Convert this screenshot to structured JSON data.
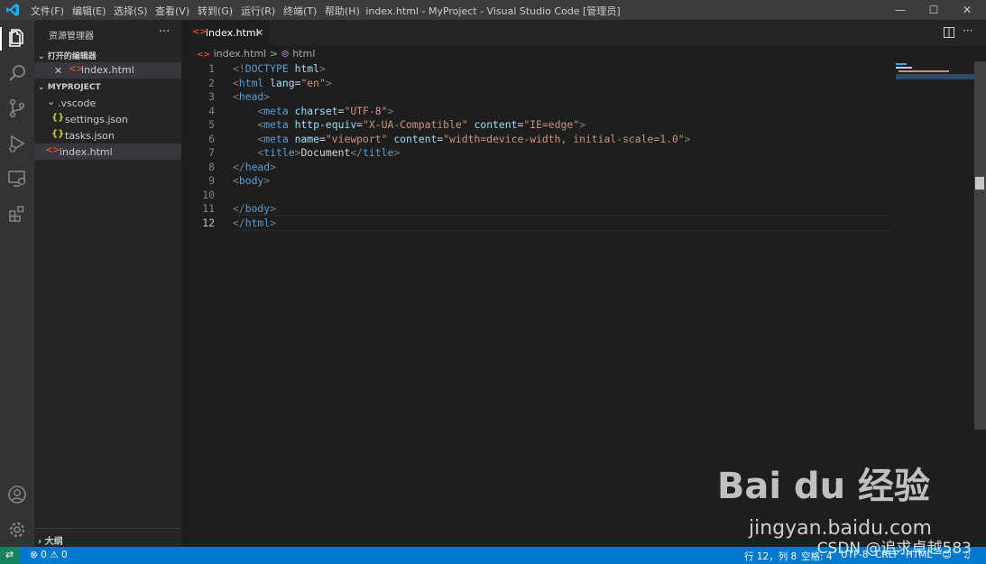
{
  "window": {
    "title": "index.html - MyProject - Visual Studio Code [管理员]",
    "menu": [
      "文件(F)",
      "编辑(E)",
      "选择(S)",
      "查看(V)",
      "转到(G)",
      "运行(R)",
      "终端(T)",
      "帮助(H)"
    ],
    "controls": {
      "minimize": "—",
      "maximize": "☐",
      "close": "✕"
    }
  },
  "activity_bar": {
    "icons": [
      "explorer-icon",
      "search-icon",
      "source-control-icon",
      "run-debug-icon",
      "remote-explorer-icon",
      "extensions-icon",
      "account-icon",
      "settings-gear-icon"
    ]
  },
  "sidebar": {
    "title": "资源管理器",
    "more": "···",
    "open_editors": {
      "heading": "打开的编辑器",
      "items": [
        {
          "close": "✕",
          "icon": "html-file-icon",
          "label": "index.html"
        }
      ]
    },
    "project": {
      "heading": "MYPROJECT",
      "items": [
        {
          "label": ".vscode",
          "icon": "folder-expanded-chevron-icon",
          "glyph": "⌄"
        },
        {
          "label": "settings.json",
          "icon": "json-file-icon",
          "glyph": "{}"
        },
        {
          "label": "tasks.json",
          "icon": "json-file-icon",
          "glyph": "{}"
        },
        {
          "label": "index.html",
          "icon": "html-file-icon",
          "glyph": "<>"
        }
      ]
    },
    "outline": {
      "heading": "大纲"
    }
  },
  "editor": {
    "tab": {
      "label": "index.html",
      "close": "✕"
    },
    "breadcrumb": {
      "file": "index.html",
      "separator": ">",
      "symbol": "html"
    },
    "lines": [
      {
        "num": "1",
        "tokens": [
          [
            "tag-b",
            "<!"
          ],
          [
            "tag-n",
            "DOCTYPE "
          ],
          [
            "attr",
            "html"
          ],
          [
            "tag-b",
            ">"
          ]
        ]
      },
      {
        "num": "2",
        "tokens": [
          [
            "tag-b",
            "<"
          ],
          [
            "tag-n",
            "html "
          ],
          [
            "attr",
            "lang"
          ],
          [
            "txt",
            "="
          ],
          [
            "str",
            "\"en\""
          ],
          [
            "tag-b",
            ">"
          ]
        ]
      },
      {
        "num": "3",
        "tokens": [
          [
            "tag-b",
            "<"
          ],
          [
            "tag-n",
            "head"
          ],
          [
            "tag-b",
            ">"
          ]
        ]
      },
      {
        "num": "4",
        "tokens": [
          [
            "txt",
            "    "
          ],
          [
            "tag-b",
            "<"
          ],
          [
            "tag-n",
            "meta "
          ],
          [
            "attr",
            "charset"
          ],
          [
            "txt",
            "="
          ],
          [
            "str",
            "\"UTF-8\""
          ],
          [
            "tag-b",
            ">"
          ]
        ]
      },
      {
        "num": "5",
        "tokens": [
          [
            "txt",
            "    "
          ],
          [
            "tag-b",
            "<"
          ],
          [
            "tag-n",
            "meta "
          ],
          [
            "attr",
            "http-equiv"
          ],
          [
            "txt",
            "="
          ],
          [
            "str",
            "\"X-UA-Compatible\" "
          ],
          [
            "attr",
            "content"
          ],
          [
            "txt",
            "="
          ],
          [
            "str",
            "\"IE=edge\""
          ],
          [
            "tag-b",
            ">"
          ]
        ]
      },
      {
        "num": "6",
        "tokens": [
          [
            "txt",
            "    "
          ],
          [
            "tag-b",
            "<"
          ],
          [
            "tag-n",
            "meta "
          ],
          [
            "attr",
            "name"
          ],
          [
            "txt",
            "="
          ],
          [
            "str",
            "\"viewport\" "
          ],
          [
            "attr",
            "content"
          ],
          [
            "txt",
            "="
          ],
          [
            "str",
            "\"width=device-width, initial-scale=1.0\""
          ],
          [
            "tag-b",
            ">"
          ]
        ]
      },
      {
        "num": "7",
        "tokens": [
          [
            "txt",
            "    "
          ],
          [
            "tag-b",
            "<"
          ],
          [
            "tag-n",
            "title"
          ],
          [
            "tag-b",
            ">"
          ],
          [
            "txt",
            "Document"
          ],
          [
            "tag-b",
            "</"
          ],
          [
            "tag-n",
            "title"
          ],
          [
            "tag-b",
            ">"
          ]
        ]
      },
      {
        "num": "8",
        "tokens": [
          [
            "tag-b",
            "</"
          ],
          [
            "tag-n",
            "head"
          ],
          [
            "tag-b",
            ">"
          ]
        ]
      },
      {
        "num": "9",
        "tokens": [
          [
            "tag-b",
            "<"
          ],
          [
            "tag-n",
            "body"
          ],
          [
            "tag-b",
            ">"
          ]
        ]
      },
      {
        "num": "10",
        "tokens": []
      },
      {
        "num": "11",
        "tokens": [
          [
            "tag-b",
            "</"
          ],
          [
            "tag-n",
            "body"
          ],
          [
            "tag-b",
            ">"
          ]
        ]
      },
      {
        "num": "12",
        "tokens": [
          [
            "tag-b",
            "</"
          ],
          [
            "tag-n",
            "html"
          ],
          [
            "tag-b",
            ">"
          ]
        ]
      }
    ],
    "active_line": "12"
  },
  "status_bar": {
    "remote": "⇄",
    "errors": "0",
    "warnings": "0",
    "position": "行 12，列 8",
    "indent": "空格: 4",
    "encoding": "UTF-8",
    "eol": "CRLF",
    "language": "HTML"
  },
  "watermark": {
    "logo": "Bai du 经验",
    "domain": "jingyan.baidu.com",
    "csdn": "CSDN @追求卓越583"
  },
  "colors": {
    "accent": "#007acc",
    "titlebar": "#3c3c3c",
    "activitybar": "#333333",
    "sidebar": "#252526",
    "editor": "#1e1e1e",
    "html_icon": "#e44d26",
    "json_icon": "#cbcb41"
  }
}
